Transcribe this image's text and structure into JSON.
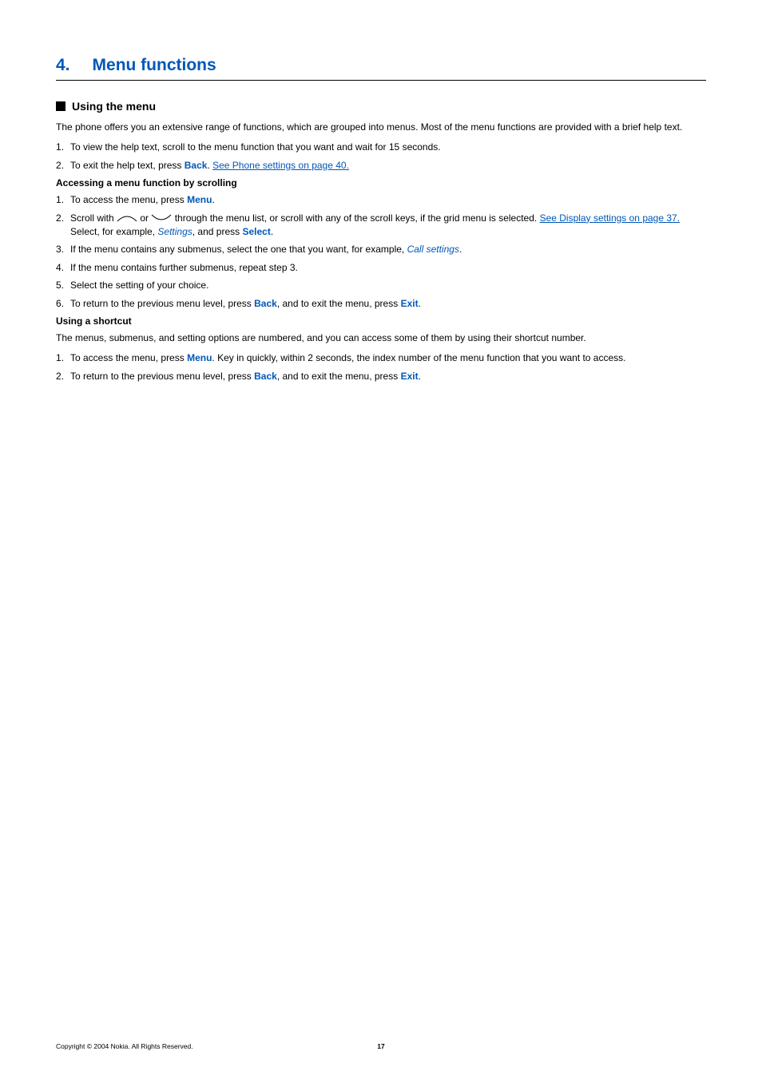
{
  "chapter": {
    "number": "4.",
    "title": "Menu functions"
  },
  "section": {
    "title": "Using the menu",
    "intro": "The phone offers you an extensive range of functions, which are grouped into menus. Most of the menu functions are provided with a brief help text.",
    "help_steps": {
      "s1": "To view the help text, scroll to the menu function that you want and wait for 15 seconds.",
      "s2_a": "To exit the help text, press ",
      "s2_back": "Back",
      "s2_b": ". ",
      "s2_link": "See Phone settings on page 40."
    },
    "subheading1": "Accessing a menu function by scrolling",
    "access_steps": {
      "s1_a": "To access the menu, press ",
      "s1_menu": "Menu",
      "s1_b": ".",
      "s2_a": "Scroll with ",
      "s2_b": " or ",
      "s2_c": " through the menu list, or scroll with any of the scroll keys, if the grid menu is selected. ",
      "s2_link": "See Display settings on page 37.",
      "s2_d": " Select, for example, ",
      "s2_settings": "Settings",
      "s2_e": ", and press ",
      "s2_select": "Select",
      "s2_f": ".",
      "s3_a": "If the menu contains any submenus, select the one that you want, for example, ",
      "s3_call": "Call settings",
      "s3_b": ".",
      "s4": "If the menu contains further submenus, repeat step 3.",
      "s5": "Select the setting of your choice.",
      "s6_a": "To return to the previous menu level, press ",
      "s6_back": "Back",
      "s6_b": ", and to exit the menu, press ",
      "s6_exit": "Exit",
      "s6_c": "."
    },
    "subheading2": "Using a shortcut",
    "shortcut_intro": "The menus, submenus, and setting options are numbered, and you can access some of them by using their shortcut number.",
    "shortcut_steps": {
      "s1_a": "To access the menu, press ",
      "s1_menu": "Menu",
      "s1_b": ". Key in quickly, within 2 seconds, the index number of the menu function that you want to access.",
      "s2_a": "To return to the previous menu level, press ",
      "s2_back": "Back",
      "s2_b": ", and to exit the menu, press ",
      "s2_exit": "Exit",
      "s2_c": "."
    }
  },
  "footer": {
    "copyright": "Copyright © 2004 Nokia. All Rights Reserved.",
    "page": "17"
  }
}
